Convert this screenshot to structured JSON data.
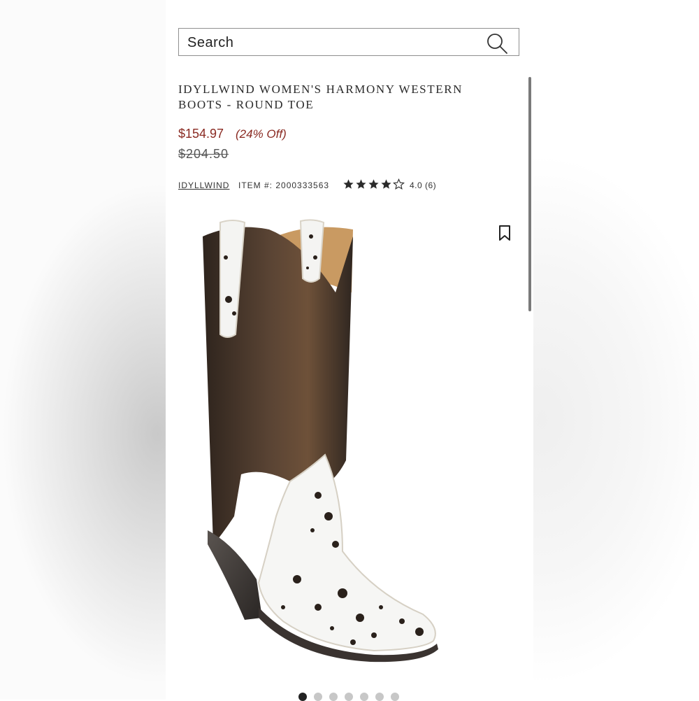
{
  "search": {
    "label": "Search"
  },
  "product": {
    "title_line1": "IDYLLWIND WOMEN'S HARMONY WESTERN",
    "title_line2": "BOOTS - ROUND TOE",
    "price": "$154.97",
    "discount": "(24% Off)",
    "original_price": "$204.50",
    "brand": "IDYLLWIND",
    "item_number": "ITEM #: 2000333563",
    "rating": {
      "value": 4.0,
      "max": 5,
      "label": "4.0 (6)"
    }
  },
  "gallery": {
    "image_count": 7,
    "active_index": 0
  },
  "colors": {
    "price": "#8a2a22",
    "star": "#2b2b2b"
  }
}
